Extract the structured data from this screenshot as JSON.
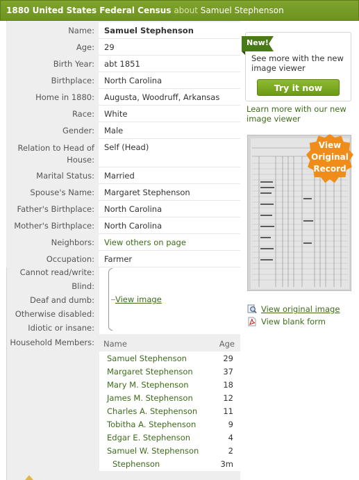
{
  "header": {
    "database": "1880 United States Federal Census",
    "about_word": "about",
    "person": "Samuel Stephenson"
  },
  "record": [
    {
      "label": "Name:",
      "value": "Samuel Stephenson"
    },
    {
      "label": "Age:",
      "value": "29"
    },
    {
      "label": "Birth Year:",
      "value": "abt 1851"
    },
    {
      "label": "Birthplace:",
      "value": "North Carolina"
    },
    {
      "label": "Home in 1880:",
      "value": "Augusta, Woodruff, Arkansas"
    },
    {
      "label": "Race:",
      "value": "White"
    },
    {
      "label": "Gender:",
      "value": "Male"
    },
    {
      "label": "Relation to Head of House:",
      "value": "Self (Head)"
    },
    {
      "label": "Marital Status:",
      "value": "Married"
    },
    {
      "label": "Spouse's Name:",
      "value": "Margaret Stephenson"
    },
    {
      "label": "Father's Birthplace:",
      "value": "North Carolina"
    },
    {
      "label": "Mother's Birthplace:",
      "value": "North Carolina"
    },
    {
      "label": "Neighbors:",
      "value": "View others on page"
    },
    {
      "label": "Occupation:",
      "value": "Farmer"
    }
  ],
  "conditions": {
    "labels": [
      "Cannot read/write:",
      "Blind:",
      "Deaf and dumb:",
      "Otherwise disabled:",
      "Idiotic or insane:"
    ],
    "link": "View image"
  },
  "household": {
    "label": "Household Members:",
    "col_name": "Name",
    "col_age": "Age",
    "members": [
      {
        "name": "Samuel Stephenson",
        "age": "29"
      },
      {
        "name": "Margaret Stephenson",
        "age": "37"
      },
      {
        "name": "Mary M. Stephenson",
        "age": "18"
      },
      {
        "name": "James M. Stephenson",
        "age": "12"
      },
      {
        "name": "Charles A. Stephenson",
        "age": "11"
      },
      {
        "name": "Tobitha A. Stephenson",
        "age": "9"
      },
      {
        "name": "Edgar E. Stephenson",
        "age": "4"
      },
      {
        "name": "Samuel W. Stephenson",
        "age": "2"
      },
      {
        "name": "Stephenson",
        "age": "3m"
      }
    ]
  },
  "promo": {
    "new_tag": "New!",
    "text": "See more with the new image viewer",
    "button": "Try it now",
    "learn_more": "Learn more with our new image viewer"
  },
  "thumbnail": {
    "badge_line1": "View",
    "badge_line2": "Original",
    "badge_line3": "Record"
  },
  "side_links": {
    "view_original": "View original image",
    "view_blank": "View blank form"
  },
  "colors": {
    "title_bar": "#7fa32c",
    "link": "#3d6b1a",
    "badge": "#f08c1a",
    "button": "#7aa823"
  }
}
